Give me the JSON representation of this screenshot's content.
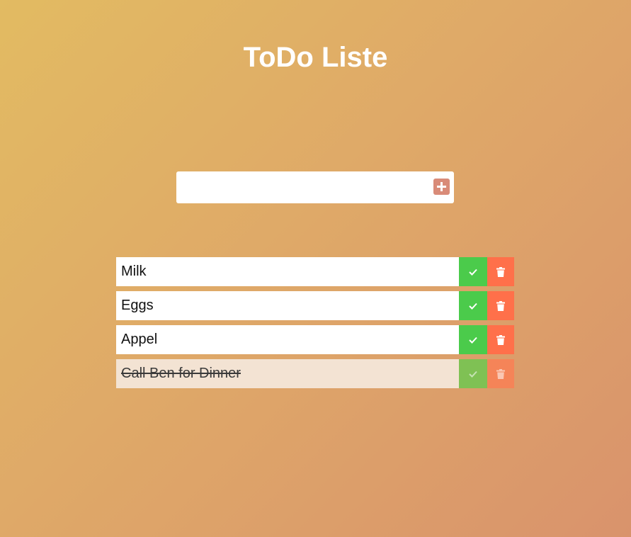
{
  "header": {
    "title": "ToDo Liste"
  },
  "add_form": {
    "input_value": "",
    "input_placeholder": "",
    "add_button_icon": "plus-icon"
  },
  "todos": [
    {
      "text": "Milk",
      "completed": false
    },
    {
      "text": "Eggs",
      "completed": false
    },
    {
      "text": "Appel",
      "completed": false
    },
    {
      "text": "Call Ben for Dinner",
      "completed": true
    }
  ],
  "icons": {
    "check": "check-icon",
    "trash": "trash-icon"
  },
  "colors": {
    "check_button": "#4bcb4b",
    "trash_button": "#ff704a",
    "add_button": "#d98b78",
    "completed_row": "#f3e3d3"
  }
}
